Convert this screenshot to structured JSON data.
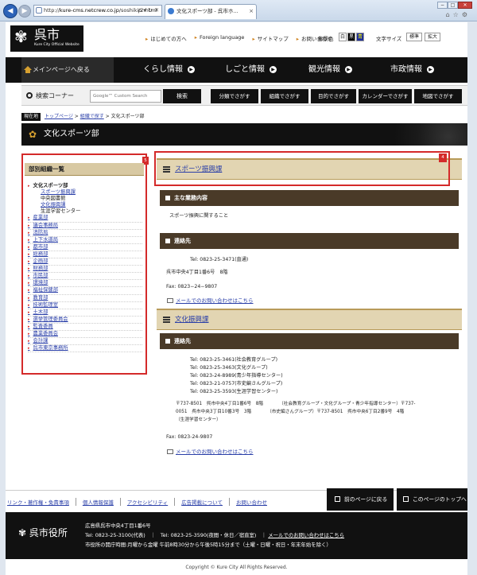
{
  "browser": {
    "url_prefix": "http://",
    "url_domain": "kure-cms.netcrew.co.jp",
    "url_path": "/soshiki/2.html",
    "addr_tools": "ρ ▾ ↻ ✕",
    "tab_title": "文化スポーツ部 - 呉市ホ...",
    "tab_close": "×",
    "win_min": "−",
    "win_max": "□",
    "win_close": "✕",
    "icons": "⌂☆⚙"
  },
  "header": {
    "logo_text": "呉市",
    "logo_sub": "Kure City Official Website",
    "util_links": [
      "はじめての方へ",
      "Foreign language",
      "サイトマップ",
      "お問い合わせ"
    ],
    "bg_label": "背景色",
    "bg_white": "白",
    "bg_black": "黒",
    "bg_blue": "青",
    "fs_label": "文字サイズ",
    "fs_std": "標準",
    "fs_lg": "拡大"
  },
  "nav": {
    "home": "メインページへ戻る",
    "items": [
      "くらし情報",
      "しごと情報",
      "観光情報",
      "市政情報"
    ]
  },
  "search": {
    "label": "検索コーナー",
    "placeholder": "Google™ Custom Search",
    "button": "検索",
    "categories": [
      "分類でさがす",
      "組織でさがす",
      "目的でさがす",
      "カレンダーでさがす",
      "地図でさがす"
    ]
  },
  "breadcrumb": {
    "tag": "現在地",
    "items": [
      "トップページ",
      "組織で探す"
    ],
    "sep": ">",
    "current": "文化スポーツ部"
  },
  "page_title": "文化スポーツ部",
  "sidebar": {
    "title": "部別組織一覧",
    "marker": "5",
    "root": "文化スポーツ部",
    "subs": [
      {
        "label": "スポーツ振興課",
        "link": true
      },
      {
        "label": "中央図書館",
        "link": false
      },
      {
        "label": "文化振興課",
        "link": true
      },
      {
        "label": "生涯学習センター",
        "link": false
      }
    ],
    "items": [
      "産業部",
      "議会事務局",
      "消防局",
      "上下水道局",
      "都市部",
      "総務部",
      "企画部",
      "財務部",
      "市民部",
      "環境部",
      "福祉保健部",
      "教育部",
      "技術監理室",
      "土木部",
      "選挙管理委員会",
      "監査委員",
      "農業委員会",
      "会計課",
      "呉市東京事務所"
    ]
  },
  "main": {
    "marker": "4",
    "sec1_title": "スポーツ振興課",
    "sec1_sub1": "主な業務内容",
    "sec1_desc": "スポーツ振興に関すること",
    "sec1_sub2": "連絡先",
    "sec1_tel": "Tel: 0823-25-3471(直通)",
    "sec1_addr": "呉市中央4丁目1番6号　8階",
    "sec1_fax": "Fax: 0823−24−9807",
    "sec1_mail": "メールでのお問い合わせはこちら",
    "sec2_title": "文化振興課",
    "sec2_sub": "連絡先",
    "sec2_tels": [
      "Tel: 0823-25-3461(社会教育グループ)",
      "Tel: 0823-25-3463(文化グループ)",
      "Tel: 0823-24-8989(青少年指導センター)",
      "Tel: 0823-21-0757(市史編さんグループ)",
      "Tel: 0823-25-3593(生涯学習センター)"
    ],
    "sec2_addr_l1": "〒737-8501　呉市中央4丁目1番6号　8階　　　　（社会教育グループ・文化グループ・青少年指導センター）〒737-",
    "sec2_addr_l2": "0051　呉市中央3丁目10番3号　3階　　　　（市史編さんグループ）〒737-8501　呉市中央6丁目2番9号　4階",
    "sec2_addr_l3": "（生涯学習センター）",
    "sec2_fax": "Fax: 0823-24-9807",
    "sec2_mail": "メールでのお問い合わせはこちら"
  },
  "footer": {
    "links": [
      "リンク・著作権・免責事項",
      "個人情報保護",
      "アクセシビリティ",
      "広告掲載について",
      "お問い合わせ"
    ],
    "back_btn": "前のページに戻る",
    "top_btn": "このページのトップへ",
    "logo": "呉市役所",
    "addr": "広島県呉市中央4丁目1番6号",
    "tel": "Tel: 0823-25-3100(代表)　｜　Tel: 0823-25-3590(夜間・休日／宿直室)　｜",
    "mail_link": "メールでのお問い合わせはこちら",
    "hours": "市役所の開庁時間:月曜から金曜 午前8時30分から午後5時15分まで（土曜・日曜・祝日・年末年始を除く）",
    "copyright": "Copyright © Kure City All Rights Reserved."
  }
}
